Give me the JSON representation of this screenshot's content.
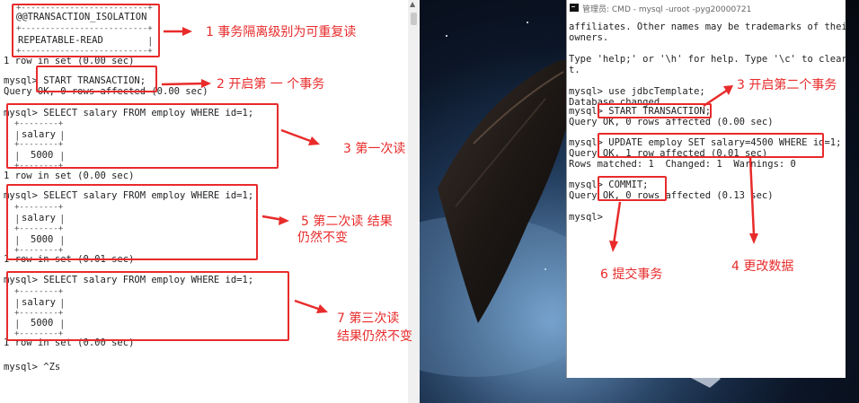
{
  "left_console": {
    "isolation_header": "@@TRANSACTION_ISOLATION",
    "isolation_value": "REPEATABLE-READ",
    "rows_1": "1 row in set (0.00 sec)",
    "start_tx_cmd": "mysql> START TRANSACTION;",
    "start_tx_ok": "Query OK, 0 rows affected (0.00 sec)",
    "select_1": "mysql> SELECT salary FROM employ WHERE id=1;",
    "col_1": "salary",
    "val_1": "5000",
    "rows_2": "1 row in set (0.00 sec)",
    "select_2": "mysql> SELECT salary FROM employ WHERE id=1;",
    "col_2": "salary",
    "val_2": "5000",
    "rows_3": "1 row in set (0.01 sec)",
    "select_3": "mysql> SELECT salary FROM employ WHERE id=1;",
    "col_3": "salary",
    "val_3": "5000",
    "rows_4": "1 row in set (0.00 sec)",
    "last_prompt": "mysql> ^Zs"
  },
  "right_console": {
    "title": "管理员: CMD - mysql -uroot -pyg20000721",
    "line_1": "affiliates. Other names may be trademarks of their re",
    "line_2": "owners.",
    "line_3": "Type 'help;' or '\\h' for help. Type '\\c' to clear the",
    "line_4": "t.",
    "use_cmd": "mysql> use jdbcTemplate;",
    "db_changed": "Database changed",
    "start_tx_cmd": "mysql> START TRANSACTION;",
    "start_tx_ok": "Query OK, 0 rows affected (0.00 sec)",
    "update_cmd": "mysql> UPDATE employ SET salary=4500 WHERE id=1;",
    "update_ok": "Query OK, 1 row affected (0.01 sec)",
    "rows_matched": "Rows matched: 1  Changed: 1  Warnings: 0",
    "commit_cmd": "mysql> COMMIT;",
    "commit_ok": "Query OK, 0 rows affected (0.13 sec)",
    "prompt": "mysql>"
  },
  "annotations": {
    "a1": "1 事务隔离级别为可重复读",
    "a2": "2 开启第 一 个事务",
    "a3": "3 第一次读",
    "a5_line1": "5 第二次读 结果",
    "a5_line2": "仍然不变",
    "a7_line1": "7 第三次读",
    "a7_line2": "结果仍然不变",
    "b3": "3 开启第二个事务",
    "b4": "4 更改数据",
    "b6": "6 提交事务"
  },
  "colors": {
    "annotation_red": "#e82b2b"
  }
}
